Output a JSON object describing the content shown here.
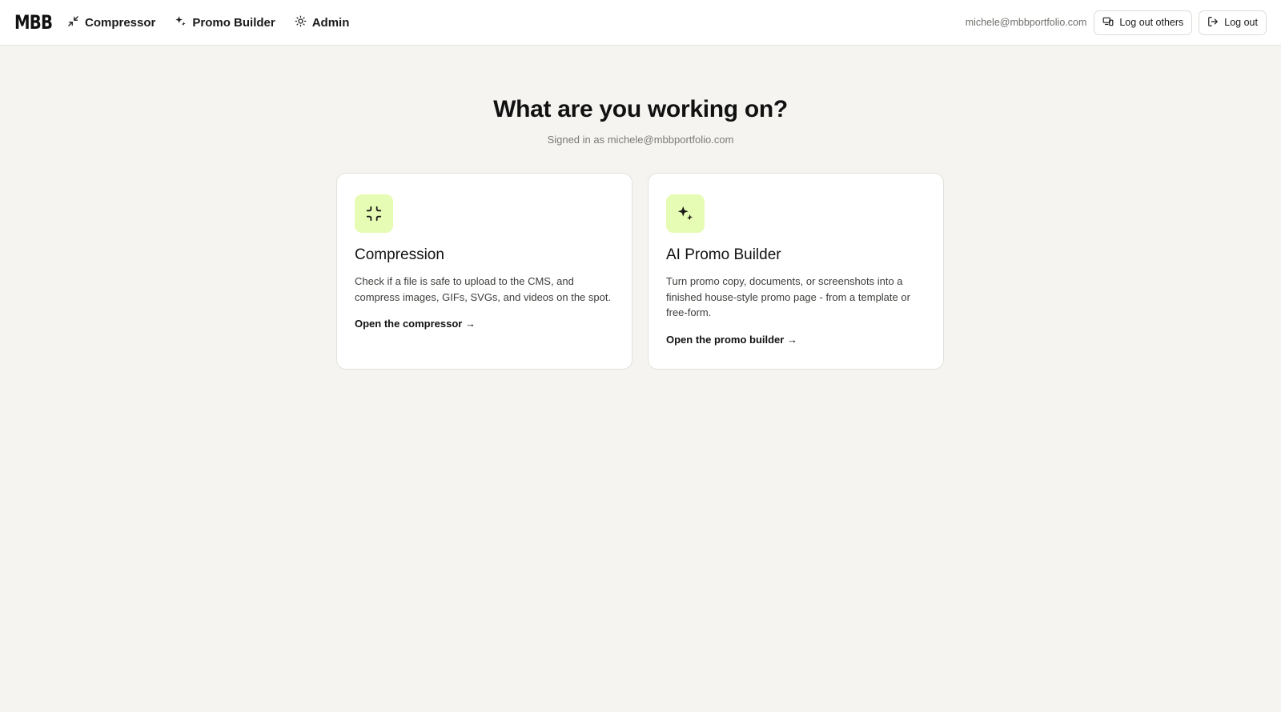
{
  "header": {
    "logo": "MBB",
    "nav": [
      {
        "label": "Compressor",
        "icon": "minimize-icon"
      },
      {
        "label": "Promo Builder",
        "icon": "sparkles-icon"
      },
      {
        "label": "Admin",
        "icon": "sun-icon"
      }
    ],
    "email": "michele@mbbportfolio.com",
    "logout_others_label": "Log out others",
    "logout_label": "Log out"
  },
  "main": {
    "title": "What are you working on?",
    "subtitle": "Signed in as michele@mbbportfolio.com",
    "cards": [
      {
        "title": "Compression",
        "description": "Check if a file is safe to upload to the CMS, and compress images, GIFs, SVGs, and videos on the spot.",
        "link": "Open the compressor →",
        "icon": "minimize-icon"
      },
      {
        "title": "AI Promo Builder",
        "description": "Turn promo copy, documents, or screenshots into a finished house-style promo page - from a template or free-form.",
        "link": "Open the promo builder →",
        "icon": "sparkles-icon"
      }
    ]
  },
  "colors": {
    "background": "#f5f4f0",
    "card_icon_bg": "#e6fbb3",
    "text_primary": "#111111",
    "text_muted": "#7a7a76"
  }
}
